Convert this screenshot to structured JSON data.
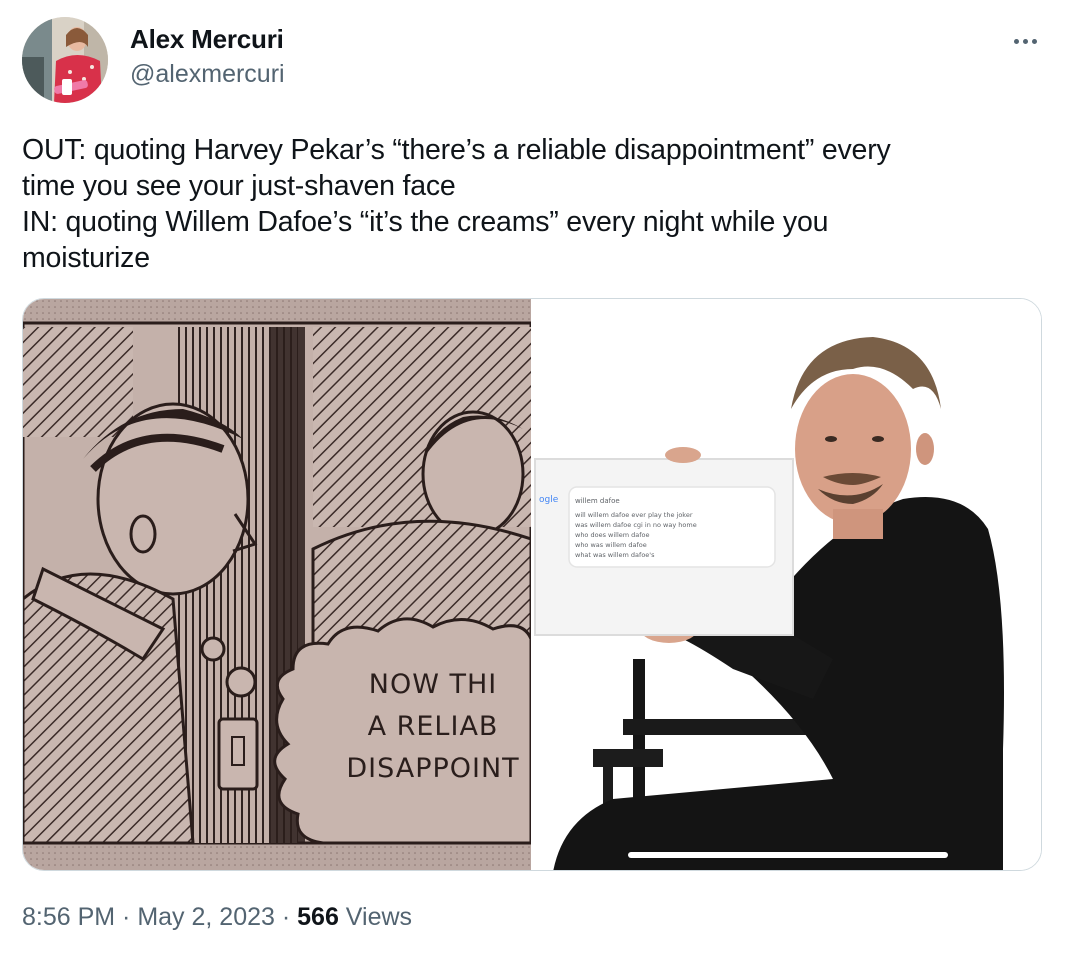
{
  "author": {
    "name": "Alex Mercuri",
    "handle": "@alexmercuri"
  },
  "tweet": {
    "lines": [
      "OUT: quoting Harvey Pekar’s “there’s a reliable disappointment” every",
      "time you see your just-shaven face",
      "IN: quoting Willem Dafoe’s “it’s the creams” every night while you",
      "moisturize"
    ]
  },
  "media": {
    "left_image": {
      "bubble_lines": [
        "NOW THI",
        "A RELIAB",
        "DISAPPOINT"
      ]
    },
    "right_image": {
      "search_logo": "ogle",
      "search_query": "willem dafoe",
      "suggestions": [
        "will willem dafoe ever play the joker",
        "was willem dafoe cgi in no way home",
        "who does willem dafoe",
        "who was willem dafoe",
        "what was willem dafoe's"
      ]
    }
  },
  "meta": {
    "time": "8:56 PM",
    "separator": " · ",
    "date": "May 2, 2023",
    "views_count": "566",
    "views_label": " Views"
  },
  "icons": {
    "more": "more-horizontal-icon"
  },
  "colors": {
    "text_primary": "#0f1419",
    "text_secondary": "#536471",
    "border": "#cfd9de"
  }
}
